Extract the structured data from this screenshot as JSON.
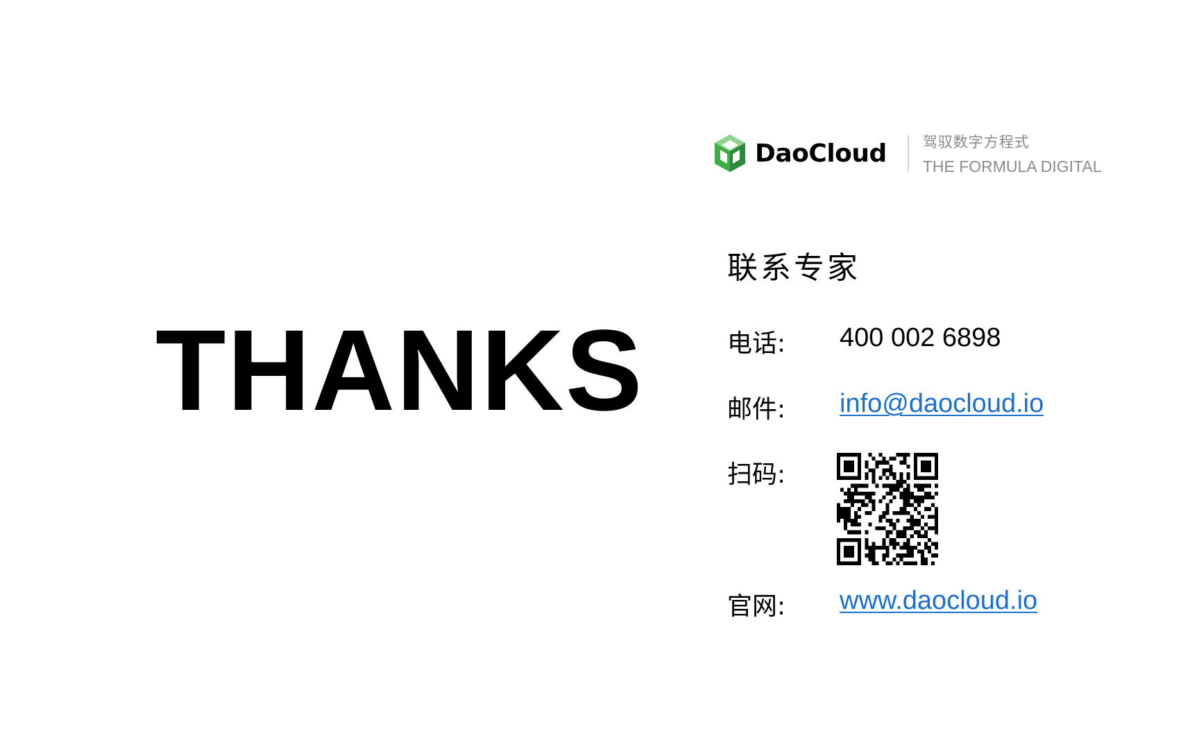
{
  "slide": {
    "headline": "THANKS"
  },
  "logo": {
    "name": "DaoCloud",
    "tagline_cn": "驾驭数字方程式",
    "tagline_en": "THE FORMULA DIGITAL",
    "colors": {
      "green": "#3fae49",
      "dark_green": "#2b8a37",
      "light_green": "#8fd48f"
    }
  },
  "contact": {
    "title": "联系专家",
    "phone_label": "电话:",
    "phone_value": "400 002 6898",
    "email_label": "邮件:",
    "email_value": "info@daocloud.io",
    "scan_label": "扫码:",
    "website_label": "官网:",
    "website_value": "www.daocloud.io",
    "link_color": "#1a6fd1"
  }
}
